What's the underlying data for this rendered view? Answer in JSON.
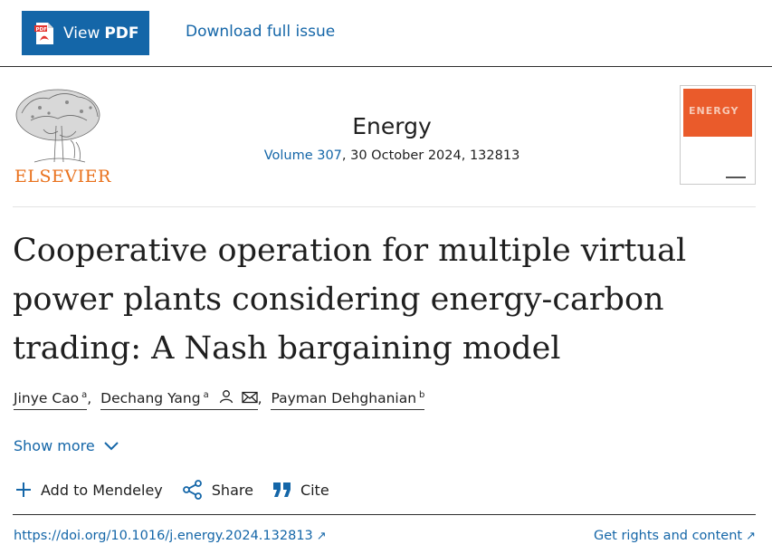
{
  "toolbar": {
    "view_label": "View",
    "pdf_label": "PDF",
    "pdf_icon_text": "PDF",
    "download_label": "Download full issue"
  },
  "header": {
    "publisher": "ELSEVIER",
    "journal": "Energy",
    "volume_link": "Volume 307",
    "issue_rest": ", 30 October 2024, 132813",
    "cover_title": "ENERGY"
  },
  "article": {
    "title_line1": "Cooperative operation for multiple virtual",
    "title_line2": "power plants considering energy-carbon",
    "title_line3": "trading: A Nash bargaining model",
    "authors": [
      {
        "name": "Jinye Cao",
        "aff": "a"
      },
      {
        "name": "Dechang Yang",
        "aff": "a"
      },
      {
        "name": "Payman Dehghanian",
        "aff": "b"
      }
    ],
    "separator": ","
  },
  "show_more": "Show more",
  "actions": {
    "mendeley": "Add to Mendeley",
    "share": "Share",
    "cite": "Cite"
  },
  "links": {
    "doi": "https://doi.org/10.1016/j.energy.2024.132813",
    "rights": "Get rights and content",
    "ext_arrow": "↗"
  },
  "colors": {
    "link_blue": "#1466a8",
    "elsevier_orange": "#e9711c",
    "cover_orange": "#ea5b2b"
  }
}
